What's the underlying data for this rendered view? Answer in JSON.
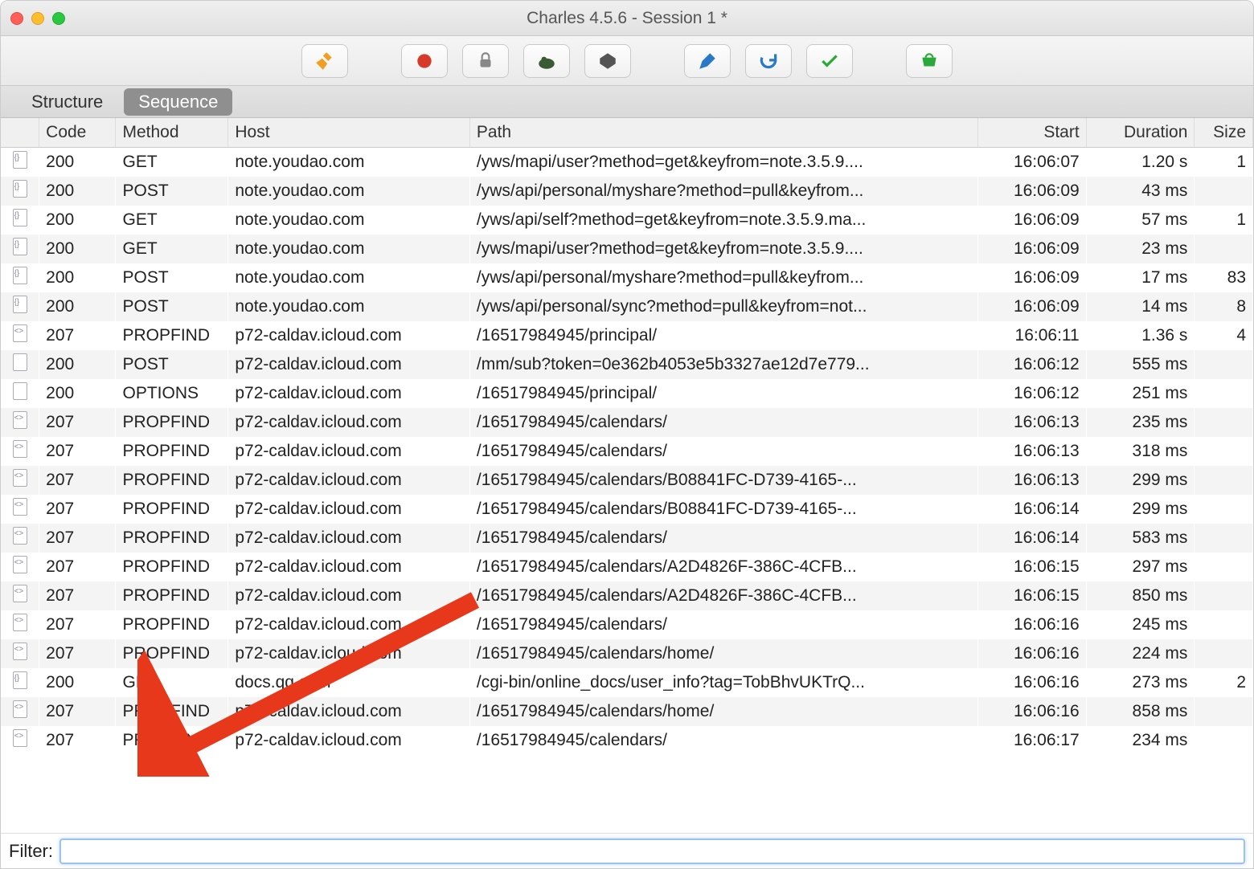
{
  "window": {
    "title": "Charles 4.5.6 - Session 1 *"
  },
  "tabs": {
    "structure": "Structure",
    "sequence": "Sequence"
  },
  "columns": {
    "code": "Code",
    "method": "Method",
    "host": "Host",
    "path": "Path",
    "start": "Start",
    "duration": "Duration",
    "size": "Size"
  },
  "filter": {
    "label": "Filter:",
    "value": ""
  },
  "rows": [
    {
      "icon": "code",
      "code": "200",
      "method": "GET",
      "host": "note.youdao.com",
      "path": "/yws/mapi/user?method=get&keyfrom=note.3.5.9....",
      "start": "16:06:07",
      "duration": "1.20 s",
      "size": "1"
    },
    {
      "icon": "code",
      "code": "200",
      "method": "POST",
      "host": "note.youdao.com",
      "path": "/yws/api/personal/myshare?method=pull&keyfrom...",
      "start": "16:06:09",
      "duration": "43 ms",
      "size": ""
    },
    {
      "icon": "code",
      "code": "200",
      "method": "GET",
      "host": "note.youdao.com",
      "path": "/yws/api/self?method=get&keyfrom=note.3.5.9.ma...",
      "start": "16:06:09",
      "duration": "57 ms",
      "size": "1"
    },
    {
      "icon": "code",
      "code": "200",
      "method": "GET",
      "host": "note.youdao.com",
      "path": "/yws/mapi/user?method=get&keyfrom=note.3.5.9....",
      "start": "16:06:09",
      "duration": "23 ms",
      "size": ""
    },
    {
      "icon": "code",
      "code": "200",
      "method": "POST",
      "host": "note.youdao.com",
      "path": "/yws/api/personal/myshare?method=pull&keyfrom...",
      "start": "16:06:09",
      "duration": "17 ms",
      "size": "83"
    },
    {
      "icon": "code",
      "code": "200",
      "method": "POST",
      "host": "note.youdao.com",
      "path": "/yws/api/personal/sync?method=pull&keyfrom=not...",
      "start": "16:06:09",
      "duration": "14 ms",
      "size": "8"
    },
    {
      "icon": "xml",
      "code": "207",
      "method": "PROPFIND",
      "host": "p72-caldav.icloud.com",
      "path": "/16517984945/principal/",
      "start": "16:06:11",
      "duration": "1.36 s",
      "size": "4"
    },
    {
      "icon": "file",
      "code": "200",
      "method": "POST",
      "host": "p72-caldav.icloud.com",
      "path": "/mm/sub?token=0e362b4053e5b3327ae12d7e779...",
      "start": "16:06:12",
      "duration": "555 ms",
      "size": ""
    },
    {
      "icon": "file",
      "code": "200",
      "method": "OPTIONS",
      "host": "p72-caldav.icloud.com",
      "path": "/16517984945/principal/",
      "start": "16:06:12",
      "duration": "251 ms",
      "size": ""
    },
    {
      "icon": "xml",
      "code": "207",
      "method": "PROPFIND",
      "host": "p72-caldav.icloud.com",
      "path": "/16517984945/calendars/",
      "start": "16:06:13",
      "duration": "235 ms",
      "size": ""
    },
    {
      "icon": "xml",
      "code": "207",
      "method": "PROPFIND",
      "host": "p72-caldav.icloud.com",
      "path": "/16517984945/calendars/",
      "start": "16:06:13",
      "duration": "318 ms",
      "size": ""
    },
    {
      "icon": "xml",
      "code": "207",
      "method": "PROPFIND",
      "host": "p72-caldav.icloud.com",
      "path": "/16517984945/calendars/B08841FC-D739-4165-...",
      "start": "16:06:13",
      "duration": "299 ms",
      "size": ""
    },
    {
      "icon": "xml",
      "code": "207",
      "method": "PROPFIND",
      "host": "p72-caldav.icloud.com",
      "path": "/16517984945/calendars/B08841FC-D739-4165-...",
      "start": "16:06:14",
      "duration": "299 ms",
      "size": ""
    },
    {
      "icon": "xml",
      "code": "207",
      "method": "PROPFIND",
      "host": "p72-caldav.icloud.com",
      "path": "/16517984945/calendars/",
      "start": "16:06:14",
      "duration": "583 ms",
      "size": ""
    },
    {
      "icon": "xml",
      "code": "207",
      "method": "PROPFIND",
      "host": "p72-caldav.icloud.com",
      "path": "/16517984945/calendars/A2D4826F-386C-4CFB...",
      "start": "16:06:15",
      "duration": "297 ms",
      "size": ""
    },
    {
      "icon": "xml",
      "code": "207",
      "method": "PROPFIND",
      "host": "p72-caldav.icloud.com",
      "path": "/16517984945/calendars/A2D4826F-386C-4CFB...",
      "start": "16:06:15",
      "duration": "850 ms",
      "size": ""
    },
    {
      "icon": "xml",
      "code": "207",
      "method": "PROPFIND",
      "host": "p72-caldav.icloud.com",
      "path": "/16517984945/calendars/",
      "start": "16:06:16",
      "duration": "245 ms",
      "size": ""
    },
    {
      "icon": "xml",
      "code": "207",
      "method": "PROPFIND",
      "host": "p72-caldav.icloud.com",
      "path": "/16517984945/calendars/home/",
      "start": "16:06:16",
      "duration": "224 ms",
      "size": ""
    },
    {
      "icon": "code",
      "code": "200",
      "method": "GET",
      "host": "docs.qq.com",
      "path": "/cgi-bin/online_docs/user_info?tag=TobBhvUKTrQ...",
      "start": "16:06:16",
      "duration": "273 ms",
      "size": "2"
    },
    {
      "icon": "xml",
      "code": "207",
      "method": "PROPFIND",
      "host": "p72-caldav.icloud.com",
      "path": "/16517984945/calendars/home/",
      "start": "16:06:16",
      "duration": "858 ms",
      "size": ""
    },
    {
      "icon": "xml",
      "code": "207",
      "method": "PROPFIND",
      "host": "p72-caldav.icloud.com",
      "path": "/16517984945/calendars/",
      "start": "16:06:17",
      "duration": "234 ms",
      "size": ""
    }
  ]
}
